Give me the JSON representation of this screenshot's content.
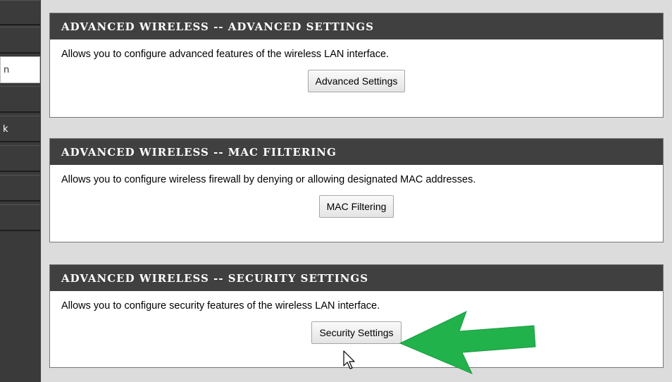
{
  "sidebar": {
    "items": [
      {
        "label": ""
      },
      {
        "label": ""
      },
      {
        "label": "n"
      },
      {
        "label": ""
      },
      {
        "label": "k"
      },
      {
        "label": ""
      },
      {
        "label": ""
      },
      {
        "label": ""
      }
    ]
  },
  "panels": {
    "advanced": {
      "title": "ADVANCED WIRELESS -- ADVANCED SETTINGS",
      "description": "Allows you to configure advanced features of the wireless LAN interface.",
      "button_label": "Advanced Settings"
    },
    "mac": {
      "title": "ADVANCED WIRELESS -- MAC FILTERING",
      "description": "Allows you to configure wireless firewall by denying or allowing designated MAC addresses.",
      "button_label": "MAC Filtering"
    },
    "security": {
      "title": "ADVANCED WIRELESS -- SECURITY SETTINGS",
      "description": "Allows you to configure security features of the wireless LAN interface.",
      "button_label": "Security Settings"
    }
  },
  "annotation": {
    "arrow_icon": "green-arrow-icon",
    "arrow_color": "#22b24c",
    "cursor_icon": "mouse-pointer-icon"
  }
}
